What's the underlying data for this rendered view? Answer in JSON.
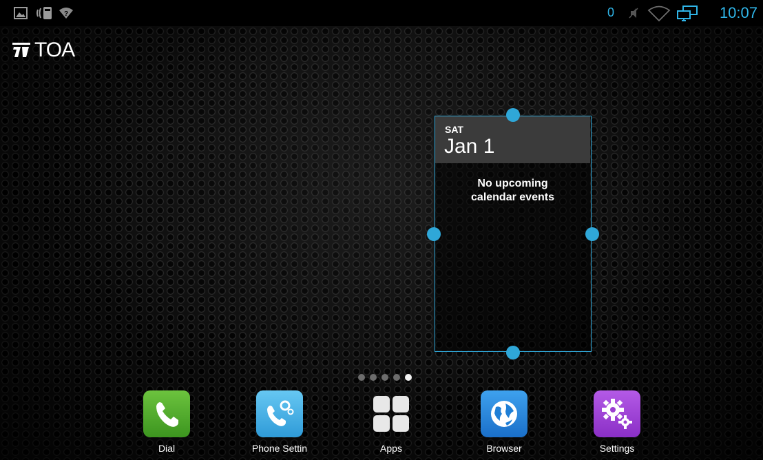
{
  "status_bar": {
    "icons": [
      "gallery-icon",
      "usb-debug-icon",
      "wifi-question-icon",
      "notification-badge",
      "mute-icon",
      "wifi-icon",
      "network-monitor-icon"
    ],
    "badge": "0",
    "time": "10:07",
    "accent_color": "#2fb5e8"
  },
  "logo": {
    "text": "TOA"
  },
  "calendar_widget": {
    "day": "SAT",
    "date": "Jan 1",
    "message_line1": "No upcoming",
    "message_line2": "calendar events",
    "selection_color": "#2fa7d8"
  },
  "pager": {
    "count": 5,
    "active_index": 4
  },
  "dock": [
    {
      "label": "Dial",
      "icon": "phone-icon",
      "color": "#4aa82a"
    },
    {
      "label": "Phone Settin",
      "icon": "phone-settings-icon",
      "color": "#3aa6e0"
    },
    {
      "label": "Apps",
      "icon": "apps-grid-icon",
      "color": "#e6e6e6"
    },
    {
      "label": "Browser",
      "icon": "globe-icon",
      "color": "#1f7fd6"
    },
    {
      "label": "Settings",
      "icon": "gear-icon",
      "color": "#9b3fd0"
    }
  ]
}
